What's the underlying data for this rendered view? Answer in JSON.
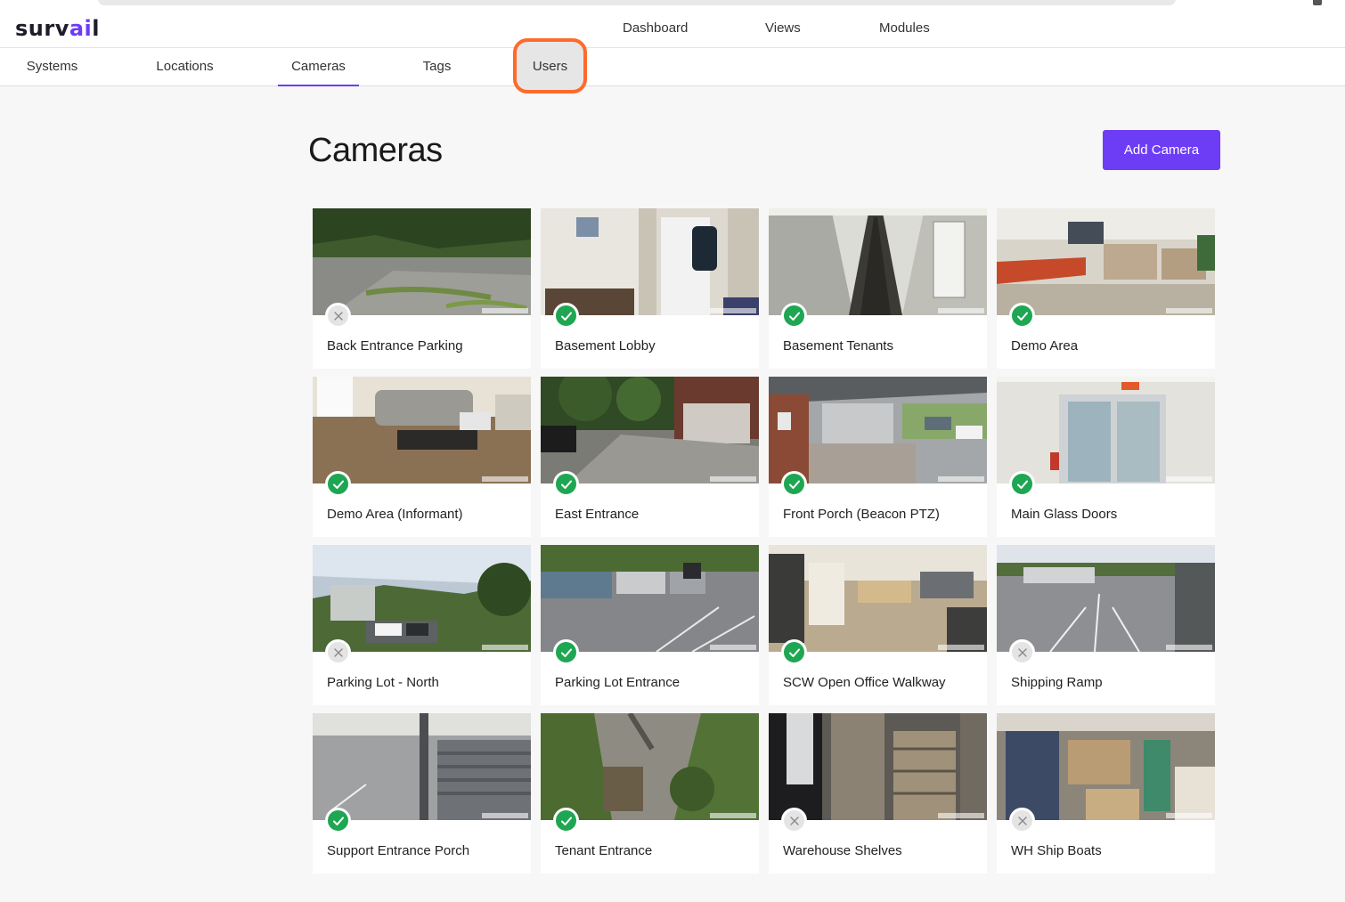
{
  "app": {
    "logo_prefix": "surv",
    "logo_accent": "ai",
    "logo_suffix": "l",
    "accent_color": "#6d3cf5"
  },
  "topnav": {
    "items": [
      "Dashboard",
      "Views",
      "Modules"
    ]
  },
  "subnav": {
    "tabs": [
      "Systems",
      "Locations",
      "Cameras",
      "Tags",
      "Users"
    ],
    "active": "Cameras",
    "highlighted": "Users"
  },
  "page": {
    "title": "Cameras",
    "add_button": "Add Camera"
  },
  "status_colors": {
    "online": "#1fa653",
    "offline": "#e4e4e4"
  },
  "cameras": [
    {
      "name": "Back Entrance Parking",
      "online": false,
      "scene": "lot-trees"
    },
    {
      "name": "Basement Lobby",
      "online": true,
      "scene": "room-kiosk"
    },
    {
      "name": "Basement Tenants",
      "online": true,
      "scene": "hallway"
    },
    {
      "name": "Demo Area",
      "online": true,
      "scene": "office-lounge"
    },
    {
      "name": "Demo Area (Informant)",
      "online": true,
      "scene": "living-room"
    },
    {
      "name": "East Entrance",
      "online": true,
      "scene": "driveway-trees"
    },
    {
      "name": "Front Porch (Beacon PTZ)",
      "online": true,
      "scene": "porch"
    },
    {
      "name": "Main Glass Doors",
      "online": true,
      "scene": "glass-doors"
    },
    {
      "name": "Parking Lot - North",
      "online": false,
      "scene": "hillside"
    },
    {
      "name": "Parking Lot Entrance",
      "online": true,
      "scene": "parking-cars"
    },
    {
      "name": "SCW Open Office Walkway",
      "online": true,
      "scene": "open-office"
    },
    {
      "name": "Shipping Ramp",
      "online": false,
      "scene": "lot-lines"
    },
    {
      "name": "Support Entrance Porch",
      "online": true,
      "scene": "stairs"
    },
    {
      "name": "Tenant Entrance",
      "online": true,
      "scene": "path-top"
    },
    {
      "name": "Warehouse Shelves",
      "online": false,
      "scene": "warehouse"
    },
    {
      "name": "WH Ship Boats",
      "online": false,
      "scene": "warehouse-boxes"
    }
  ]
}
